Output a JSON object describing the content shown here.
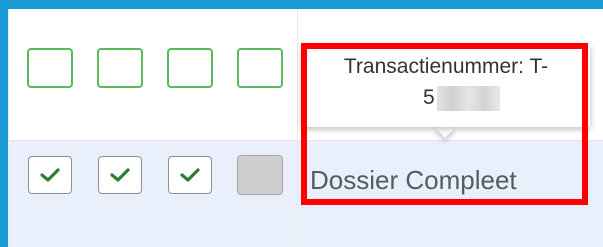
{
  "tooltip": {
    "label": "Transactienummer: T-",
    "number_visible_prefix": "5"
  },
  "row_status": {
    "text": "Dossier Compleet"
  },
  "top_row_checkboxes": [
    {
      "state": "unchecked",
      "border_color": "#5cb85c"
    },
    {
      "state": "unchecked",
      "border_color": "#5cb85c"
    },
    {
      "state": "unchecked",
      "border_color": "#5cb85c"
    },
    {
      "state": "unchecked",
      "border_color": "#5cb85c"
    }
  ],
  "bottom_row_checkboxes": [
    {
      "state": "checked",
      "check_color": "#2e7d32"
    },
    {
      "state": "checked",
      "check_color": "#2e7d32"
    },
    {
      "state": "checked",
      "check_color": "#2e7d32"
    },
    {
      "state": "disabled",
      "fill_color": "#cfcfcf"
    }
  ],
  "colors": {
    "frame_accent": "#1a9bd7",
    "highlight_border": "#ff0000",
    "selected_row_bg": "#e9f0fb"
  }
}
